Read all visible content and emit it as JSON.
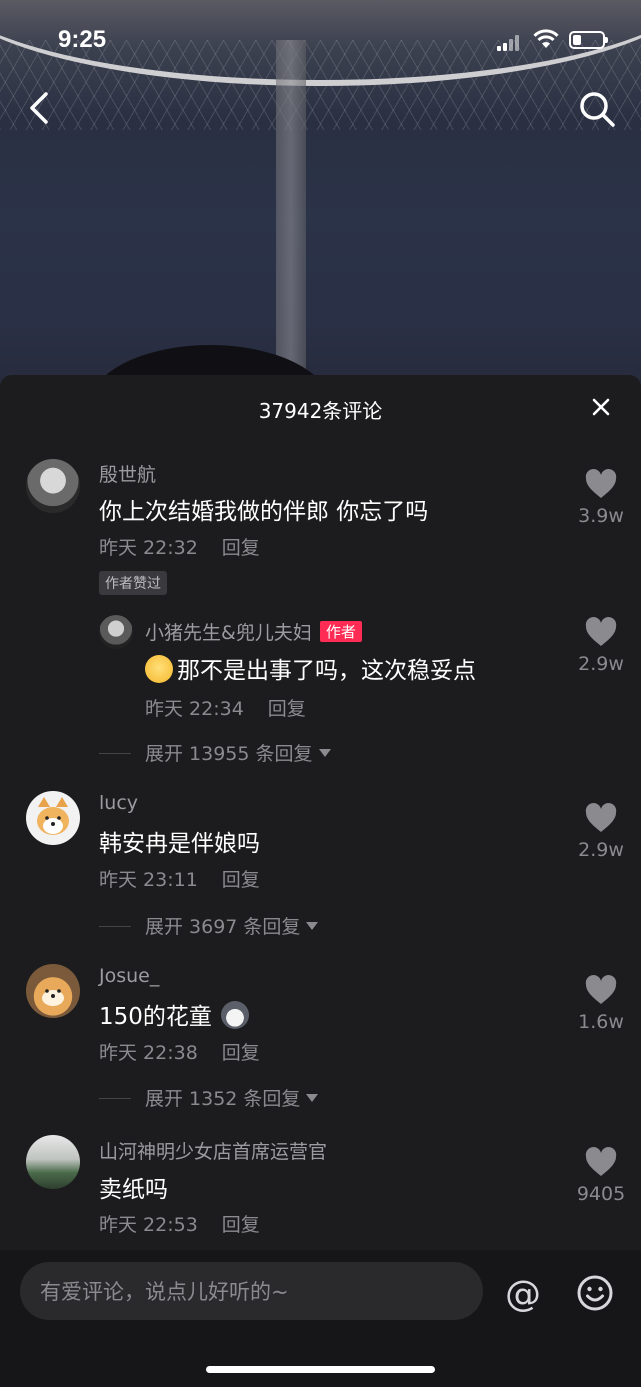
{
  "status_bar": {
    "time": "9:25"
  },
  "header": {
    "comment_count_title": "37942条评论"
  },
  "comments": [
    {
      "user": "殷世航",
      "text": "你上次结婚我做的伴郎 你忘了吗",
      "time": "昨天 22:32",
      "reply_label": "回复",
      "likes": "3.9w",
      "badge": "作者赞过",
      "reply": {
        "user": "小猪先生&兜儿夫妇",
        "author_tag": "作者",
        "text": "那不是出事了吗，这次稳妥点",
        "time": "昨天 22:34",
        "reply_label": "回复",
        "likes": "2.9w"
      },
      "expand": "展开 13955 条回复"
    },
    {
      "user": "lucy",
      "text": "韩安冉是伴娘吗",
      "time": "昨天 23:11",
      "reply_label": "回复",
      "likes": "2.9w",
      "expand": "展开 3697 条回复"
    },
    {
      "user": "Josue_",
      "text": "150的花童",
      "time": "昨天 22:38",
      "reply_label": "回复",
      "likes": "1.6w",
      "expand": "展开 1352 条回复"
    },
    {
      "user": "山河神明少女店首席运营官",
      "text": "卖纸吗",
      "time": "昨天 22:53",
      "reply_label": "回复",
      "likes": "9405"
    }
  ],
  "input": {
    "placeholder": "有爱评论，说点儿好听的~",
    "at_symbol": "@"
  },
  "colors": {
    "accent": "#fe2c55",
    "sheet_bg": "#1c1c1e",
    "muted_text": "#8a8a8f"
  }
}
